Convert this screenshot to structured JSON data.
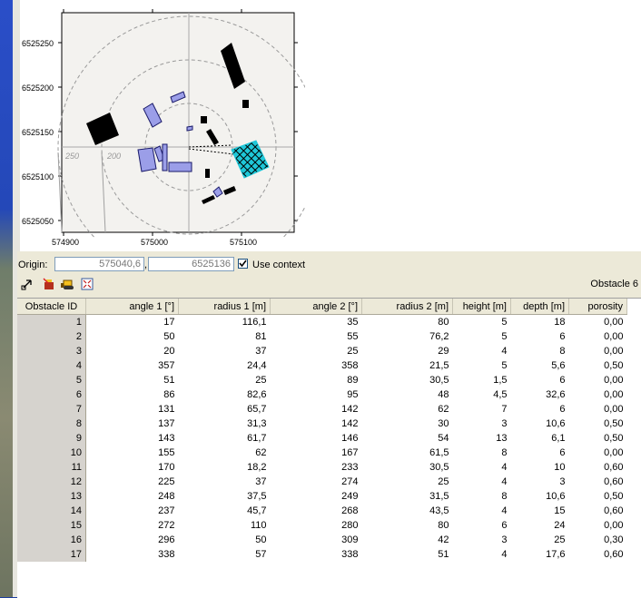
{
  "map": {
    "y_ticks": [
      "6525250",
      "6525200",
      "6525150",
      "6525100",
      "6525050"
    ],
    "x_ticks": [
      "574900",
      "575000",
      "575100"
    ],
    "ring_labels": [
      "250",
      "200"
    ]
  },
  "origin": {
    "label": "Origin:",
    "x_value": "575040,6",
    "separator": ",",
    "y_value": "6525136",
    "use_context_label": "Use context",
    "use_context_checked": true
  },
  "toolbar": {
    "icons": [
      "arrow-tool-icon",
      "delete-obstacle-icon",
      "bulldozer-icon",
      "fit-view-icon"
    ],
    "selection_title": "Obstacle 6"
  },
  "table": {
    "columns": [
      "Obstacle ID",
      "angle 1 [°]",
      "radius 1 [m]",
      "angle 2 [°]",
      "radius 2 [m]",
      "height [m]",
      "depth [m]",
      "porosity"
    ],
    "rows": [
      [
        "1",
        "17",
        "116,1",
        "35",
        "80",
        "5",
        "18",
        "0,00"
      ],
      [
        "2",
        "50",
        "81",
        "55",
        "76,2",
        "5",
        "6",
        "0,00"
      ],
      [
        "3",
        "20",
        "37",
        "25",
        "29",
        "4",
        "8",
        "0,00"
      ],
      [
        "4",
        "357",
        "24,4",
        "358",
        "21,5",
        "5",
        "5,6",
        "0,50"
      ],
      [
        "5",
        "51",
        "25",
        "89",
        "30,5",
        "1,5",
        "6",
        "0,00"
      ],
      [
        "6",
        "86",
        "82,6",
        "95",
        "48",
        "4,5",
        "32,6",
        "0,00"
      ],
      [
        "7",
        "131",
        "65,7",
        "142",
        "62",
        "7",
        "6",
        "0,00"
      ],
      [
        "8",
        "137",
        "31,3",
        "142",
        "30",
        "3",
        "10,6",
        "0,50"
      ],
      [
        "9",
        "143",
        "61,7",
        "146",
        "54",
        "13",
        "6,1",
        "0,50"
      ],
      [
        "10",
        "155",
        "62",
        "167",
        "61,5",
        "8",
        "6",
        "0,00"
      ],
      [
        "11",
        "170",
        "18,2",
        "233",
        "30,5",
        "4",
        "10",
        "0,60"
      ],
      [
        "12",
        "225",
        "37",
        "274",
        "25",
        "4",
        "3",
        "0,60"
      ],
      [
        "13",
        "248",
        "37,5",
        "249",
        "31,5",
        "8",
        "10,6",
        "0,50"
      ],
      [
        "14",
        "237",
        "45,7",
        "268",
        "43,5",
        "4",
        "15",
        "0,60"
      ],
      [
        "15",
        "272",
        "110",
        "280",
        "80",
        "6",
        "24",
        "0,00"
      ],
      [
        "16",
        "296",
        "50",
        "309",
        "42",
        "3",
        "25",
        "0,30"
      ],
      [
        "17",
        "338",
        "57",
        "338",
        "51",
        "4",
        "17,6",
        "0,60"
      ]
    ]
  },
  "colors": {
    "selected_obstacle": "#1fc7d8",
    "obstacle_blue": "#9b9ee8",
    "obstacle_black": "#000000",
    "grid_header": "#ece9d8"
  }
}
